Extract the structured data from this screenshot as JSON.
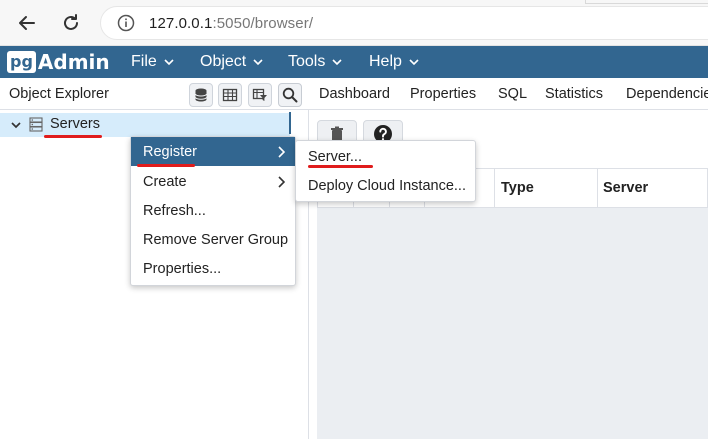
{
  "browser": {
    "url_host": "127.0.0.1",
    "url_path": ":5050/browser/"
  },
  "app": {
    "logo_pg": "pg",
    "logo_admin": "Admin",
    "menu": [
      "File",
      "Object",
      "Tools",
      "Help"
    ]
  },
  "explorer": {
    "title": "Object Explorer",
    "tree_label": "Servers",
    "tools": [
      "database-icon",
      "table-icon",
      "filter-table-icon",
      "search-icon"
    ]
  },
  "panel": {
    "tabs": [
      "Dashboard",
      "Properties",
      "SQL",
      "Statistics",
      "Dependencies"
    ],
    "columns": [
      "Type",
      "Server"
    ]
  },
  "context_menu": {
    "items": [
      "Register",
      "Create",
      "Refresh...",
      "Remove Server Group",
      "Properties..."
    ]
  },
  "submenu": {
    "items": [
      "Server...",
      "Deploy Cloud Instance..."
    ]
  },
  "colors": {
    "navbar": "#326690",
    "selection": "#d6ecfb",
    "annotation": "#e01c1c"
  }
}
